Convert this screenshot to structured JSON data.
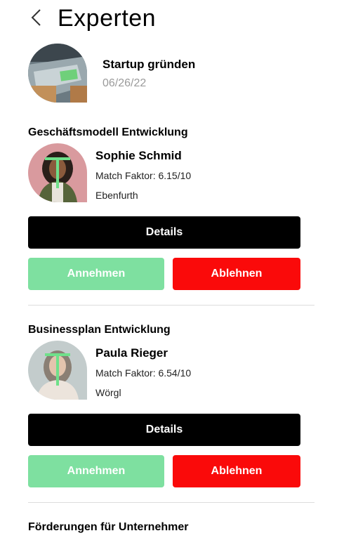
{
  "header": {
    "title": "Experten",
    "back_icon": "chevron-left-icon"
  },
  "project": {
    "title": "Startup gründen",
    "date": "06/26/22"
  },
  "sections": [
    {
      "title": "Geschäftsmodell Entwicklung",
      "expert": {
        "name": "Sophie Schmid",
        "match": "Match Faktor: 6.15/10",
        "location": "Ebenfurth"
      },
      "details_label": "Details",
      "accept_label": "Annehmen",
      "reject_label": "Ablehnen"
    },
    {
      "title": "Businessplan Entwicklung",
      "expert": {
        "name": "Paula Rieger",
        "match": "Match Faktor: 6.54/10",
        "location": "Wörgl"
      },
      "details_label": "Details",
      "accept_label": "Annehmen",
      "reject_label": "Ablehnen"
    },
    {
      "title": "Förderungen für Unternehmer"
    }
  ],
  "colors": {
    "accept": "#7ee0a0",
    "reject": "#fa0a0a",
    "details": "#000000"
  }
}
